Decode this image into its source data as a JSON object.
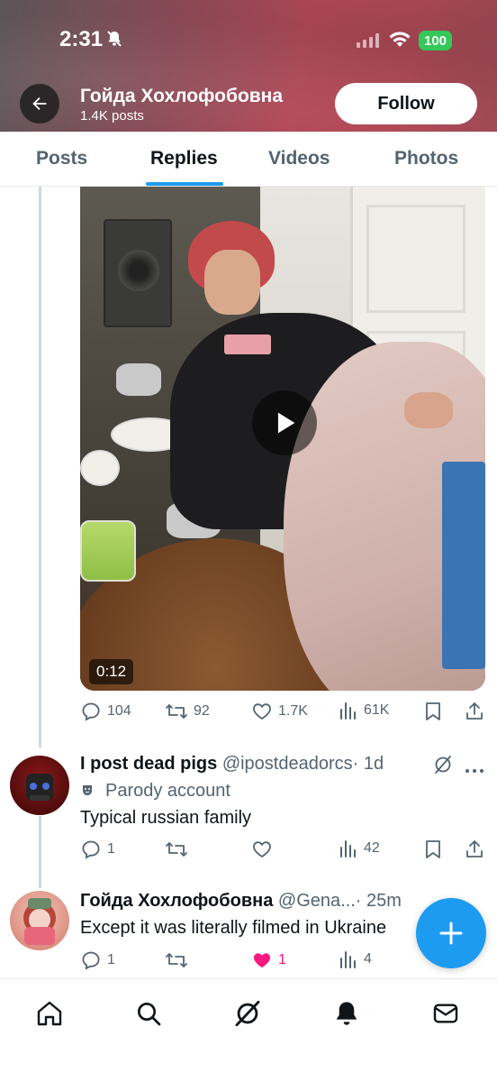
{
  "status_bar": {
    "time": "2:31",
    "battery": "100"
  },
  "header": {
    "display_name": "Гойда Хохлофобовна",
    "post_count": "1.4K posts",
    "follow_label": "Follow"
  },
  "tabs": [
    {
      "label": "Posts",
      "active": false
    },
    {
      "label": "Replies",
      "active": true
    },
    {
      "label": "Videos",
      "active": false
    },
    {
      "label": "Photos",
      "active": false
    }
  ],
  "video_post": {
    "duration": "0:12",
    "stats": {
      "replies": "104",
      "reposts": "92",
      "likes": "1.7K",
      "views": "61K"
    }
  },
  "reply_1": {
    "name": "I post dead pigs",
    "handle": "@ipostdeadorcs",
    "time": "· 1d",
    "label": "Parody account",
    "text": "Typical russian family",
    "stats": {
      "replies": "1",
      "reposts": "",
      "likes": "",
      "views": "42"
    }
  },
  "reply_2": {
    "name": "Гойда Хохлофобовна",
    "handle": "@Gena...",
    "time": "· 25m",
    "text": "Except it was literally filmed in Ukraine",
    "stats": {
      "replies": "1",
      "reposts": "",
      "likes": "1",
      "views": "4"
    }
  },
  "colors": {
    "accent": "#1d9bf0",
    "like": "#f91880",
    "secondary_text": "#536471",
    "battery": "#34c759"
  },
  "icons": {
    "nav": [
      "home-icon",
      "search-icon",
      "grok-icon",
      "notifications-icon",
      "messages-icon"
    ],
    "fab": "compose-plus-icon"
  }
}
